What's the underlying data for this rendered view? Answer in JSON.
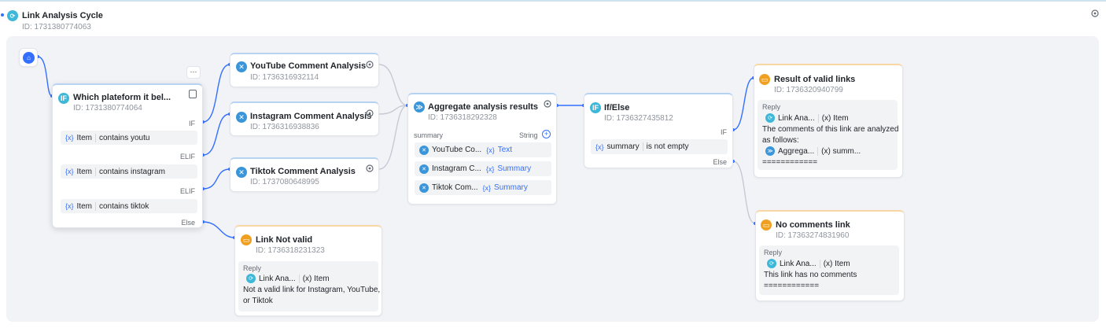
{
  "workflow": {
    "title": "Link Analysis Cycle",
    "id": "ID: 1731380774063"
  },
  "start_node": {
    "icon": "home-icon"
  },
  "if_node": {
    "title": "Which plateform it bel...",
    "id": "ID: 1731380774064",
    "conditions": [
      {
        "branch": "IF",
        "var": "{x}",
        "field": "Item",
        "text": "contains youtu"
      },
      {
        "branch": "ELIF",
        "var": "{x}",
        "field": "Item",
        "text": "contains instagram"
      },
      {
        "branch": "ELIF",
        "var": "{x}",
        "field": "Item",
        "text": "contains tiktok"
      }
    ],
    "else_label": "Else",
    "more_label": "···"
  },
  "youtube": {
    "title": "YouTube Comment Analysis",
    "id": "ID: 1736316932114"
  },
  "instagram": {
    "title": "Instagram Comment Analysis",
    "id": "ID: 1736316938836"
  },
  "tiktok": {
    "title": "Tiktok Comment Analysis",
    "id": "ID: 1737080648995"
  },
  "not_valid": {
    "title": "Link Not valid",
    "id": "ID: 1736318231323",
    "reply_label": "Reply",
    "chip_source": "Link Ana...",
    "chip_var": "(x) Item",
    "lines": [
      "Not a valid link for Instagram, YouTube,",
      "or Tiktok"
    ]
  },
  "aggregate": {
    "title": "Aggregate analysis results",
    "id": "ID: 1736318292328",
    "param_name": "summary",
    "param_type": "String",
    "rows": [
      {
        "source": "YouTube Co...",
        "var": "{x}",
        "field": "Text"
      },
      {
        "source": "Instagram C...",
        "var": "{x}",
        "field": "Summary"
      },
      {
        "source": "Tiktok Com...",
        "var": "{x}",
        "field": "Summary"
      }
    ]
  },
  "ifelse": {
    "title": "If/Else",
    "id": "ID: 1736327435812",
    "if_label": "IF",
    "else_label": "Else",
    "var": "{x}",
    "field": "summary",
    "cond": "is not empty"
  },
  "valid": {
    "title": "Result of valid links",
    "id": "ID: 1736320940799",
    "reply_label": "Reply",
    "chip_source": "Link Ana...",
    "chip_var": "(x) Item",
    "line1": "The comments of this link are analyzed",
    "line2": "as follows:",
    "chip2_source": "Aggrega...",
    "chip2_var": "(x) summ...",
    "line3": "============"
  },
  "no_comments": {
    "title": "No comments link",
    "id": "ID: 17363274831960",
    "reply_label": "Reply",
    "chip_source": "Link Ana...",
    "chip_var": "(x) Item",
    "line1": "This link has no comments",
    "line2": "============"
  },
  "colors": {
    "accent": "#3370ff",
    "llm": "#3b96d9",
    "condition": "#3db8d8",
    "message": "#f0a020"
  }
}
